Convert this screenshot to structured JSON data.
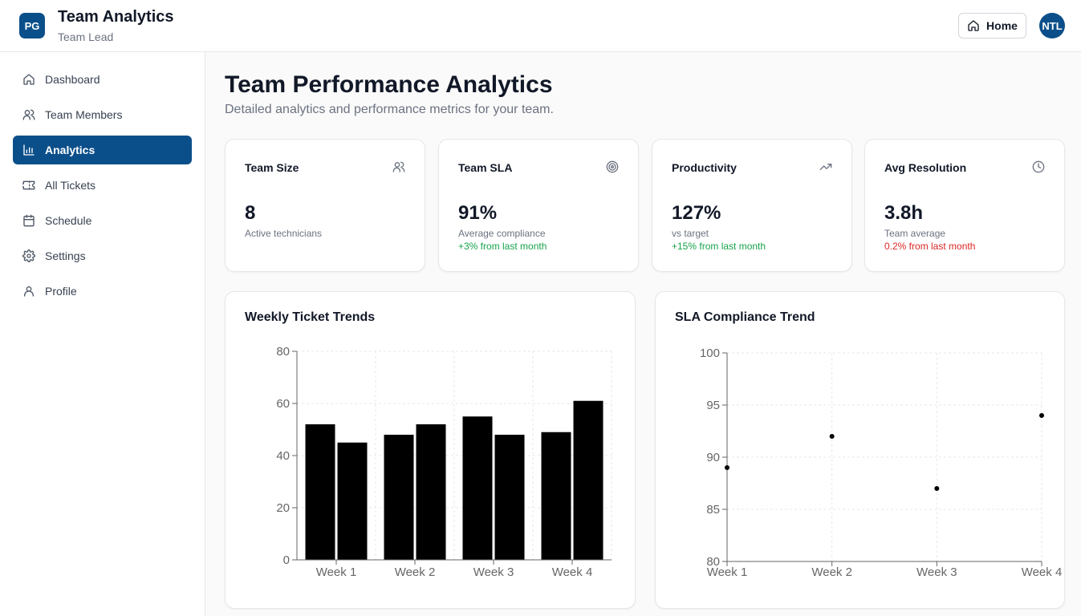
{
  "header": {
    "logo_text": "PG",
    "app_title": "Team Analytics",
    "app_subtitle": "Team Lead",
    "home_label": "Home",
    "avatar_initials": "NTL"
  },
  "sidebar": {
    "items": [
      {
        "label": "Dashboard",
        "icon": "home-icon",
        "active": false
      },
      {
        "label": "Team Members",
        "icon": "users-icon",
        "active": false
      },
      {
        "label": "Analytics",
        "icon": "bar-chart-icon",
        "active": true
      },
      {
        "label": "All Tickets",
        "icon": "ticket-icon",
        "active": false
      },
      {
        "label": "Schedule",
        "icon": "calendar-icon",
        "active": false
      },
      {
        "label": "Settings",
        "icon": "gear-icon",
        "active": false
      },
      {
        "label": "Profile",
        "icon": "user-icon",
        "active": false
      }
    ]
  },
  "page": {
    "title": "Team Performance Analytics",
    "subtitle": "Detailed analytics and performance metrics for your team."
  },
  "stats": [
    {
      "title": "Team Size",
      "icon": "users-icon",
      "value": "8",
      "desc": "Active technicians",
      "change": ""
    },
    {
      "title": "Team SLA",
      "icon": "target-icon",
      "value": "91%",
      "desc": "Average compliance",
      "change": "+3% from last month",
      "change_type": "positive"
    },
    {
      "title": "Productivity",
      "icon": "trending-up-icon",
      "value": "127%",
      "desc": "vs target",
      "change": "+15% from last month",
      "change_type": "positive"
    },
    {
      "title": "Avg Resolution",
      "icon": "clock-icon",
      "value": "3.8h",
      "desc": "Team average",
      "change": "0.2% from last month",
      "change_type": "negative"
    }
  ],
  "colors": {
    "brand": "#0b4f8a",
    "positive": "#16a34a",
    "negative": "#dc2626"
  },
  "chart_data": [
    {
      "type": "bar",
      "title": "Weekly Ticket Trends",
      "categories": [
        "Week 1",
        "Week 2",
        "Week 3",
        "Week 4"
      ],
      "series": [
        {
          "values": [
            52,
            48,
            55,
            49
          ]
        },
        {
          "values": [
            45,
            52,
            48,
            61
          ]
        }
      ],
      "ylim": [
        0,
        80
      ],
      "yticks": [
        0,
        20,
        40,
        60,
        80
      ],
      "grid": true
    },
    {
      "type": "scatter",
      "title": "SLA Compliance Trend",
      "categories": [
        "Week 1",
        "Week 2",
        "Week 3",
        "Week 4"
      ],
      "series": [
        {
          "values": [
            89,
            92,
            87,
            94
          ]
        }
      ],
      "ylim": [
        80,
        100
      ],
      "yticks": [
        80,
        85,
        90,
        95,
        100
      ],
      "grid": true
    }
  ]
}
